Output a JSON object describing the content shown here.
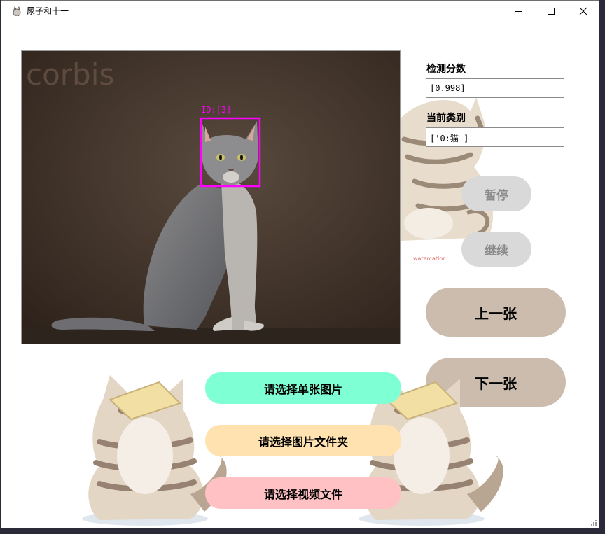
{
  "window": {
    "title": "尿子和十一"
  },
  "photo": {
    "watermark": "corbis",
    "detection_label": "ID:[3]",
    "box_color": "#ff00ff"
  },
  "panel": {
    "score_label": "检测分数",
    "score_value": "[0.998]",
    "class_label": "当前类别",
    "class_value": "['0:猫']"
  },
  "buttons": {
    "pause": "暂停",
    "resume": "继续",
    "prev": "上一张",
    "next": "下一张",
    "select_image": "请选择单张图片",
    "select_folder": "请选择图片文件夹",
    "select_video": "请选择视频文件"
  },
  "decor": {
    "sticker_text": "watercatlor"
  },
  "colors": {
    "select_image_bg": "#7effd4",
    "select_folder_bg": "#ffe2b0",
    "select_video_bg": "#ffc1c3",
    "tan": "#cbbcae",
    "gray": "#d9d9d9"
  }
}
